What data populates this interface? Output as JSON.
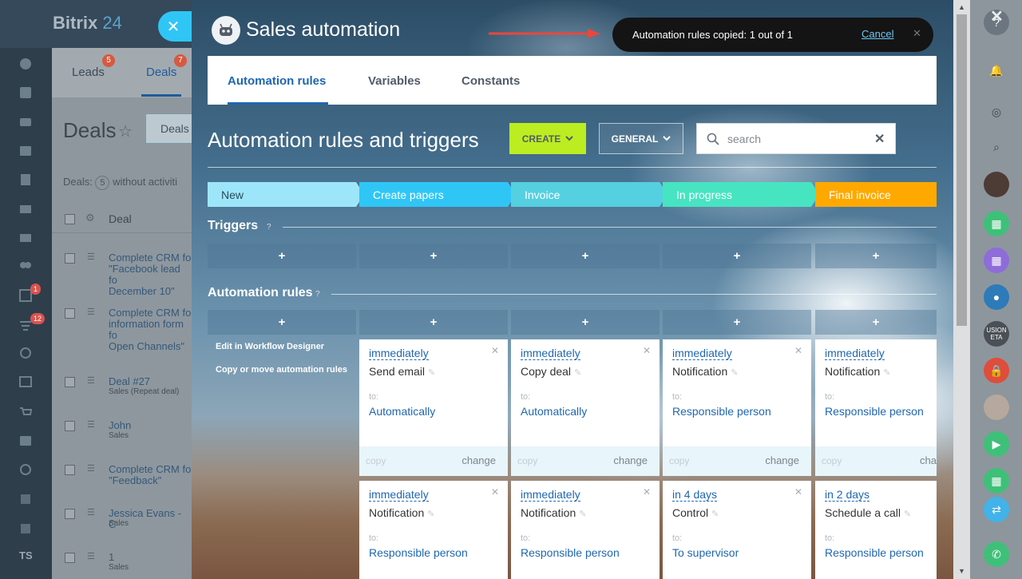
{
  "background_app": {
    "logo": {
      "main": "Bitrix",
      "num": "24"
    },
    "tabs": [
      {
        "label": "Leads",
        "badge": "5"
      },
      {
        "label": "Deals",
        "badge": "7"
      }
    ],
    "page_title": "Deals",
    "filter_chip": "Deals",
    "deals_count_prefix": "Deals:",
    "deals_count_num": "5",
    "deals_count_suffix": "without activiti",
    "column_header": "Deal",
    "leftbar_badges": [
      "1",
      "12"
    ],
    "rows": [
      {
        "title": "Complete CRM fo\n\"Facebook lead fo\nDecember 10\"",
        "sub": ""
      },
      {
        "title": "Complete CRM fo\ninformation form fo\nOpen Channels\"",
        "sub": ""
      },
      {
        "title": "Deal #27",
        "sub": "Sales (Repeat deal)"
      },
      {
        "title": "John",
        "sub": "Sales"
      },
      {
        "title": "Complete CRM fo\n\"Feedback\"",
        "sub": ""
      },
      {
        "title": "Jessica Evans - C",
        "sub": "Sales"
      },
      {
        "title": "1",
        "sub": "Sales"
      }
    ],
    "user_initials": "TS",
    "rightbar_text": "USION\nETA"
  },
  "panel": {
    "title": "Sales automation",
    "toast": {
      "message": "Automation rules copied: 1 out of 1",
      "cancel": "Cancel"
    },
    "tabs": [
      "Automation rules",
      "Variables",
      "Constants"
    ],
    "section_title": "Automation rules and triggers",
    "create_button": "CREATE",
    "general_button": "GENERAL",
    "search_placeholder": "search",
    "stages": [
      {
        "name": "New",
        "color": "#9de6fa"
      },
      {
        "name": "Create papers",
        "color": "#2fc6f6"
      },
      {
        "name": "Invoice",
        "color": "#55d0e0"
      },
      {
        "name": "In progress",
        "color": "#47e4c2"
      },
      {
        "name": "Final invoice",
        "color": "#ffa900"
      }
    ],
    "triggers_label": "Triggers",
    "rules_label": "Automation rules",
    "help_mark": "?",
    "plus": "+",
    "side_links": [
      "Edit in Workflow Designer",
      "Copy or move automation rules"
    ],
    "cards_row1": [
      {
        "when": "immediately",
        "name": "Send email",
        "to": "to:",
        "target": "Automatically",
        "copy": "copy",
        "change": "change"
      },
      {
        "when": "immediately",
        "name": "Copy deal",
        "to": "to:",
        "target": "Automatically",
        "copy": "copy",
        "change": "change"
      },
      {
        "when": "immediately",
        "name": "Notification",
        "to": "to:",
        "target": "Responsible person",
        "copy": "copy",
        "change": "change"
      },
      {
        "when": "immediately",
        "name": "Notification",
        "to": "to:",
        "target": "Responsible person",
        "copy": "copy",
        "change": "cha"
      }
    ],
    "cards_row2": [
      {
        "when": "immediately",
        "name": "Notification",
        "to": "to:",
        "target": "Responsible person"
      },
      {
        "when": "immediately",
        "name": "Notification",
        "to": "to:",
        "target": "Responsible person"
      },
      {
        "when": "in 4 days",
        "name": "Control",
        "to": "to:",
        "target": "To supervisor"
      },
      {
        "when": "in 2 days",
        "name": "Schedule a call",
        "to": "to:",
        "target": "Responsible person"
      }
    ]
  }
}
